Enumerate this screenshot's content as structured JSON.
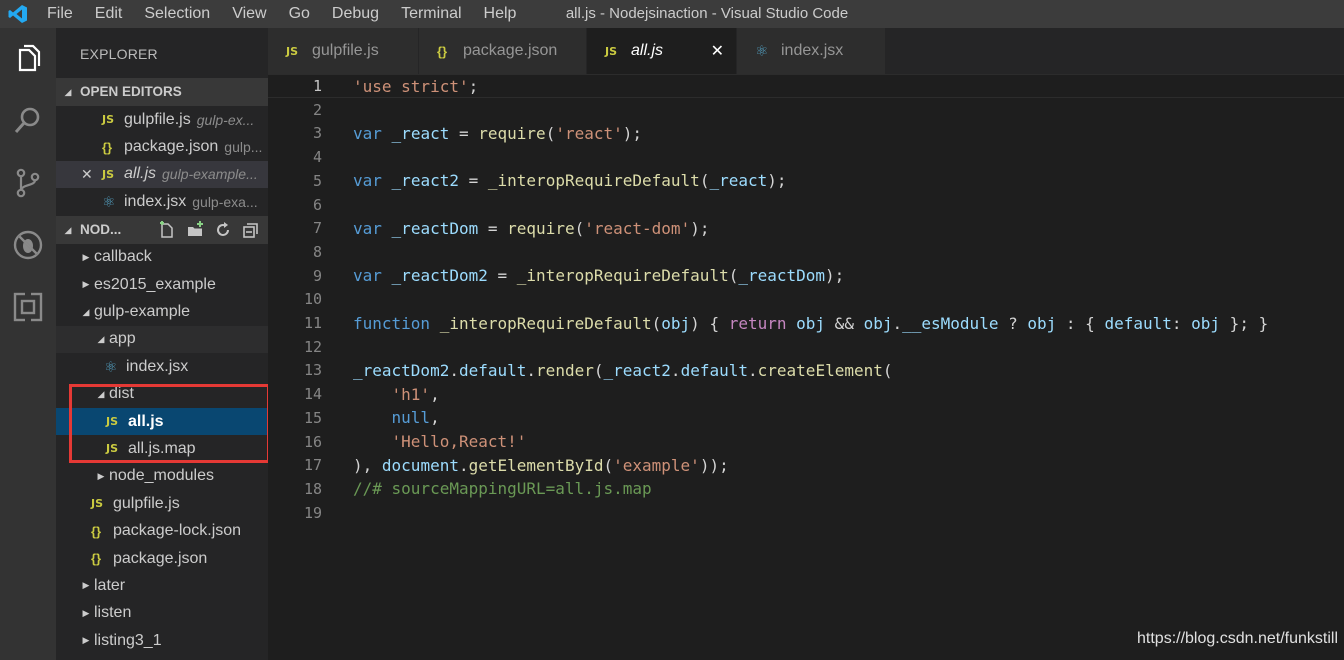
{
  "titlebar": {
    "menu": [
      "File",
      "Edit",
      "Selection",
      "View",
      "Go",
      "Debug",
      "Terminal",
      "Help"
    ],
    "window_title": "all.js - Nodejsinaction - Visual Studio Code"
  },
  "activitybar": {
    "icons": [
      "files-icon",
      "search-icon",
      "source-control-icon",
      "debug-icon",
      "extensions-icon"
    ]
  },
  "sidebar": {
    "title": "EXPLORER",
    "open_editors": {
      "header": "OPEN EDITORS",
      "items": [
        {
          "icon": "JS",
          "name": "gulpfile.js",
          "desc": "gulp-ex..."
        },
        {
          "icon": "{}",
          "name": "package.json",
          "desc": "gulp..."
        },
        {
          "icon": "JS",
          "name": "all.js",
          "desc": "gulp-example...",
          "close": "✕"
        },
        {
          "icon": "react",
          "name": "index.jsx",
          "desc": "gulp-exa..."
        }
      ]
    },
    "folder": {
      "header": "NOD...",
      "tree": [
        {
          "name": "callback"
        },
        {
          "name": "es2015_example"
        },
        {
          "name": "gulp-example"
        },
        {
          "name": "app"
        },
        {
          "name": "index.jsx"
        },
        {
          "name": "dist"
        },
        {
          "name": "all.js"
        },
        {
          "name": "all.js.map"
        },
        {
          "name": "node_modules"
        },
        {
          "name": "gulpfile.js"
        },
        {
          "name": "package-lock.json"
        },
        {
          "name": "package.json"
        },
        {
          "name": "later"
        },
        {
          "name": "listen"
        },
        {
          "name": "listing3_1"
        }
      ]
    }
  },
  "tabs": [
    {
      "icon": "JS",
      "label": "gulpfile.js"
    },
    {
      "icon": "{}",
      "label": "package.json"
    },
    {
      "icon": "JS",
      "label": "all.js",
      "close": "✕"
    },
    {
      "icon": "react",
      "label": "index.jsx"
    }
  ],
  "editor": {
    "line_numbers": [
      "1",
      "2",
      "3",
      "4",
      "5",
      "6",
      "7",
      "8",
      "9",
      "10",
      "11",
      "12",
      "13",
      "14",
      "15",
      "16",
      "17",
      "18",
      "19"
    ],
    "lines": [
      [
        [
          "str",
          "'use strict'"
        ],
        [
          "pn",
          ";"
        ]
      ],
      [],
      [
        [
          "kw",
          "var"
        ],
        [
          "pn",
          " "
        ],
        [
          "var",
          "_react"
        ],
        [
          "pn",
          " = "
        ],
        [
          "fn",
          "require"
        ],
        [
          "pn",
          "("
        ],
        [
          "str",
          "'react'"
        ],
        [
          "pn",
          ");"
        ]
      ],
      [],
      [
        [
          "kw",
          "var"
        ],
        [
          "pn",
          " "
        ],
        [
          "var",
          "_react2"
        ],
        [
          "pn",
          " = "
        ],
        [
          "fn",
          "_interopRequireDefault"
        ],
        [
          "pn",
          "("
        ],
        [
          "var",
          "_react"
        ],
        [
          "pn",
          ");"
        ]
      ],
      [],
      [
        [
          "kw",
          "var"
        ],
        [
          "pn",
          " "
        ],
        [
          "var",
          "_reactDom"
        ],
        [
          "pn",
          " = "
        ],
        [
          "fn",
          "require"
        ],
        [
          "pn",
          "("
        ],
        [
          "str",
          "'react-dom'"
        ],
        [
          "pn",
          ");"
        ]
      ],
      [],
      [
        [
          "kw",
          "var"
        ],
        [
          "pn",
          " "
        ],
        [
          "var",
          "_reactDom2"
        ],
        [
          "pn",
          " = "
        ],
        [
          "fn",
          "_interopRequireDefault"
        ],
        [
          "pn",
          "("
        ],
        [
          "var",
          "_reactDom"
        ],
        [
          "pn",
          ");"
        ]
      ],
      [],
      [
        [
          "kw",
          "function"
        ],
        [
          "pn",
          " "
        ],
        [
          "fn",
          "_interopRequireDefault"
        ],
        [
          "pn",
          "("
        ],
        [
          "var",
          "obj"
        ],
        [
          "pn",
          ") { "
        ],
        [
          "ctl",
          "return"
        ],
        [
          "pn",
          " "
        ],
        [
          "var",
          "obj"
        ],
        [
          "pn",
          " && "
        ],
        [
          "var",
          "obj"
        ],
        [
          "pn",
          "."
        ],
        [
          "var",
          "__esModule"
        ],
        [
          "pn",
          " ? "
        ],
        [
          "var",
          "obj"
        ],
        [
          "pn",
          " : { "
        ],
        [
          "var",
          "default"
        ],
        [
          "pn",
          ": "
        ],
        [
          "var",
          "obj"
        ],
        [
          "pn",
          " }; }"
        ]
      ],
      [],
      [
        [
          "var",
          "_reactDom2"
        ],
        [
          "pn",
          "."
        ],
        [
          "var",
          "default"
        ],
        [
          "pn",
          "."
        ],
        [
          "fn",
          "render"
        ],
        [
          "pn",
          "("
        ],
        [
          "var",
          "_react2"
        ],
        [
          "pn",
          "."
        ],
        [
          "var",
          "default"
        ],
        [
          "pn",
          "."
        ],
        [
          "fn",
          "createElement"
        ],
        [
          "pn",
          "("
        ]
      ],
      [
        [
          "pn",
          "    "
        ],
        [
          "str",
          "'h1'"
        ],
        [
          "pn",
          ","
        ]
      ],
      [
        [
          "pn",
          "    "
        ],
        [
          "kw",
          "null"
        ],
        [
          "pn",
          ","
        ]
      ],
      [
        [
          "pn",
          "    "
        ],
        [
          "str",
          "'Hello,React!'"
        ]
      ],
      [
        [
          "pn",
          "), "
        ],
        [
          "var",
          "document"
        ],
        [
          "pn",
          "."
        ],
        [
          "fn",
          "getElementById"
        ],
        [
          "pn",
          "("
        ],
        [
          "str",
          "'example'"
        ],
        [
          "pn",
          "));"
        ]
      ],
      [
        [
          "com",
          "//# sourceMappingURL=all.js.map"
        ]
      ],
      []
    ]
  },
  "watermark": "https://blog.csdn.net/funkstill"
}
